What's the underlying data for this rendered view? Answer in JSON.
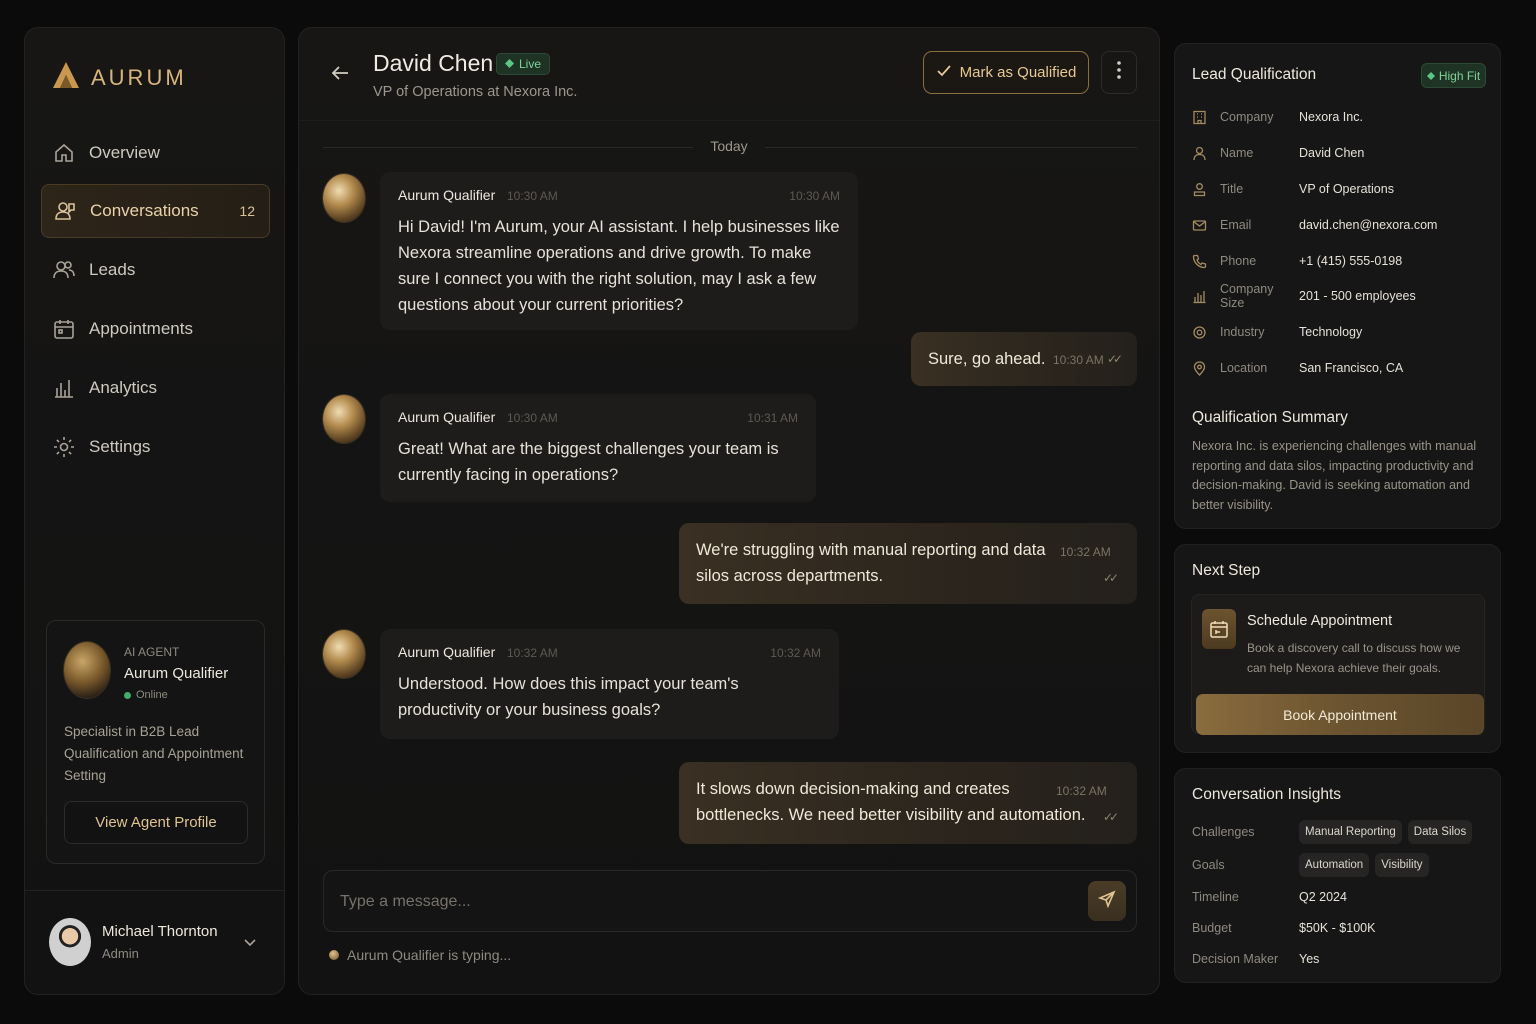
{
  "brand": {
    "name": "AURUM",
    "accent": "#d8b57a"
  },
  "nav": [
    {
      "label": "Overview",
      "icon": "home-icon"
    },
    {
      "label": "Conversations",
      "icon": "conversations-icon",
      "badge": "12",
      "active": true
    },
    {
      "label": "Leads",
      "icon": "users-icon"
    },
    {
      "label": "Appointments",
      "icon": "calendar-icon"
    },
    {
      "label": "Analytics",
      "icon": "analytics-icon"
    },
    {
      "label": "Settings",
      "icon": "gear-icon"
    }
  ],
  "agent": {
    "kicker": "AI AGENT",
    "name": "Aurum Qualifier",
    "status": "Online",
    "description": "Specialist in B2B Lead Qualification and Appointment Setting",
    "button": "View Agent Profile"
  },
  "user": {
    "name": "Michael Thornton",
    "role": "Admin"
  },
  "chat": {
    "contact_name": "David Chen",
    "live_label": "Live",
    "contact_title": "VP of Operations at Nexora Inc.",
    "qualify_label": "Mark as Qualified",
    "day_label": "Today",
    "messages": [
      {
        "from": "agent",
        "sender": "Aurum Qualifier",
        "time": "10:30 AM",
        "time2": "10:30 AM",
        "text": "Hi David! I'm Aurum, your AI assistant. I help businesses like Nexora streamline operations and drive growth. To make sure I connect you with the right solution, may I ask a few questions about your current priorities?"
      },
      {
        "from": "user",
        "time": "10:30 AM",
        "text": "Sure, go ahead."
      },
      {
        "from": "agent",
        "sender": "Aurum Qualifier",
        "time": "10:30 AM",
        "time2": "10:31 AM",
        "text": "Great! What are the biggest challenges your team is currently facing in operations?"
      },
      {
        "from": "user",
        "time": "10:32 AM",
        "text": "We're struggling with manual reporting and data silos across departments."
      },
      {
        "from": "agent",
        "sender": "Aurum Qualifier",
        "time": "10:32 AM",
        "time2": "10:32 AM",
        "text": "Understood. How does this impact your team's productivity or your business goals?"
      },
      {
        "from": "user",
        "time": "10:32 AM",
        "text": "It slows down decision-making and creates bottlenecks. We need better visibility and automation."
      }
    ],
    "composer_placeholder": "Type a message...",
    "typing_text": "Aurum Qualifier is typing..."
  },
  "lead": {
    "title": "Lead Qualification",
    "fit_label": "High Fit",
    "fields": [
      {
        "label": "Company",
        "value": "Nexora Inc.",
        "icon": "building-icon"
      },
      {
        "label": "Name",
        "value": "David Chen",
        "icon": "person-icon"
      },
      {
        "label": "Title",
        "value": "VP of Operations",
        "icon": "badge-icon"
      },
      {
        "label": "Email",
        "value": "david.chen@nexora.com",
        "icon": "mail-icon"
      },
      {
        "label": "Phone",
        "value": "+1 (415) 555-0198",
        "icon": "phone-icon"
      },
      {
        "label": "Company Size",
        "value": "201 - 500 employees",
        "icon": "bar-chart-icon"
      },
      {
        "label": "Industry",
        "value": "Technology",
        "icon": "gear-icon"
      },
      {
        "label": "Location",
        "value": "San Francisco, CA",
        "icon": "location-pin-icon"
      }
    ],
    "summary_title": "Qualification Summary",
    "summary": "Nexora Inc. is experiencing challenges with manual reporting and data silos, impacting productivity and decision-making. David is seeking automation and better visibility."
  },
  "next_step": {
    "title": "Next Step",
    "card_title": "Schedule Appointment",
    "card_desc": "Book a discovery call to discuss how we can help Nexora achieve their goals.",
    "button": "Book Appointment"
  },
  "insights": {
    "title": "Conversation Insights",
    "challenges_label": "Challenges",
    "challenges": [
      "Manual Reporting",
      "Data Silos"
    ],
    "goals_label": "Goals",
    "goals": [
      "Automation",
      "Visibility"
    ],
    "timeline_label": "Timeline",
    "timeline": "Q2 2024",
    "budget_label": "Budget",
    "budget": "$50K - $100K",
    "decision_label": "Decision Maker",
    "decision": "Yes"
  }
}
